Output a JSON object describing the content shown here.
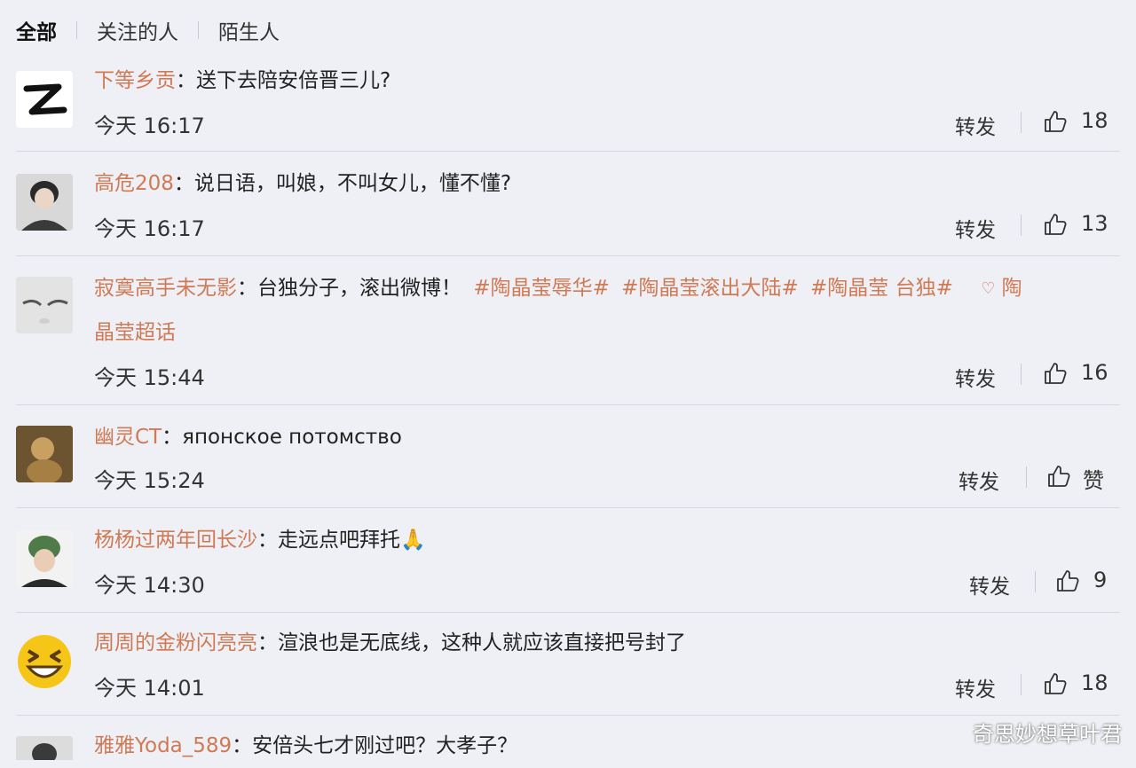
{
  "tabs": [
    "全部",
    "关注的人",
    "陌生人"
  ],
  "repost_label": "转发",
  "comments": [
    {
      "author": "下等乡贡",
      "colon": "：",
      "text": "送下去陪安倍晋三儿?",
      "time": "今天 16:17",
      "likes": "18"
    },
    {
      "author": "高危208",
      "colon": "：",
      "text": "说日语，叫娘，不叫女儿，懂不懂?",
      "time": "今天 16:17",
      "likes": "13"
    },
    {
      "author": "寂寞高手未无影",
      "colon": "：",
      "text": "台独分子，滚出微博！",
      "tags": [
        "#陶晶莹辱华#",
        "#陶晶莹滚出大陆#",
        "#陶晶莹 台独#"
      ],
      "supertopic_line1": "陶",
      "supertopic_line2": "晶莹超话",
      "time": "今天 15:44",
      "likes": "16"
    },
    {
      "author": "幽灵CT",
      "colon": "：",
      "text": "японское потомство",
      "time": "今天 15:24",
      "likes": "赞"
    },
    {
      "author": "杨杨过两年回长沙",
      "colon": "：",
      "text": "走远点吧拜托🙏",
      "time": "今天 14:30",
      "likes": "9"
    },
    {
      "author": "周周的金粉闪亮亮",
      "colon": "：",
      "text": "渲浪也是无底线，这种人就应该直接把号封了",
      "time": "今天 14:01",
      "likes": "18"
    },
    {
      "author": "雅雅Yoda_589",
      "colon": "：",
      "text": "安倍头七才刚过吧？大孝子？"
    }
  ],
  "watermark": "奇思妙想草叶君",
  "colors": {
    "accent": "#d07a55",
    "background": "#eef0f5"
  }
}
